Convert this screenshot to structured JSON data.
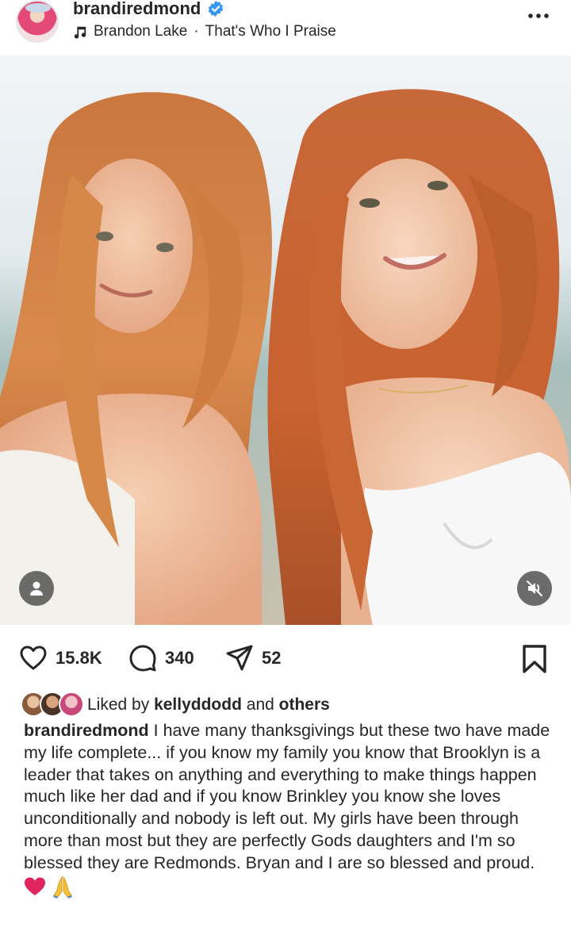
{
  "post": {
    "username": "brandiredmond",
    "verified": true,
    "music": {
      "artist": "Brandon Lake",
      "separator": "·",
      "title": "That's Who I Praise"
    }
  },
  "photo": {
    "description_icon_user": "user-tag-icon",
    "mute_icon": "speaker-muted-icon"
  },
  "actions": {
    "likes": "15.8K",
    "comments": "340",
    "shares": "52"
  },
  "liked_by": {
    "prefix": "Liked by",
    "user": "kellyddodd",
    "joiner": "and",
    "others": "others"
  },
  "caption": {
    "author": "brandiredmond",
    "text": "I have many thanksgivings but these two have made my life complete...  if you know my family you know that Brooklyn is a leader that takes on anything and everything to make things happen much like her dad and if you know Brinkley you know she loves unconditionally and nobody is left out. My girls have been through more than most  but they are perfectly Gods daughters and I'm so blessed they are Redmonds. Bryan and I are so blessed and proud.",
    "emojis": [
      "❤️",
      "🙏"
    ]
  },
  "colors": {
    "text": "#262626",
    "verified_blue": "#3897f0",
    "heart_red": "#e0245e"
  }
}
